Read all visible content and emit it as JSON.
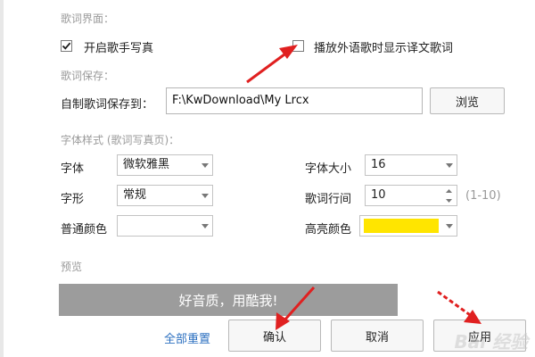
{
  "sections": {
    "lyrics_ui": "歌词界面：",
    "lyrics_save": "歌词保存：",
    "font_style": "字体样式 (歌词写真页)：",
    "preview": "预览"
  },
  "options": {
    "singer_photo": {
      "label": "开启歌手写真",
      "checked": true
    },
    "show_translation": {
      "label": "播放外语歌时显示译文歌词",
      "checked": false
    }
  },
  "save": {
    "label": "自制歌词保存到：",
    "path": "F:\\KwDownload\\My Lrcx",
    "browse_label": "浏览"
  },
  "font": {
    "family_label": "字体",
    "family_value": "微软雅黑",
    "style_label": "字形",
    "style_value": "常规",
    "normal_color_label": "普通颜色",
    "normal_color": "#ffffff",
    "size_label": "字体大小",
    "size_value": "16",
    "line_spacing_label": "歌词行间",
    "line_spacing_value": "10",
    "line_spacing_range": "(1-10)",
    "highlight_color_label": "高亮颜色",
    "highlight_color": "#ffe500"
  },
  "preview_text": "好音质，用酷我!",
  "footer": {
    "reset_label": "全部重置",
    "ok_label": "确认",
    "cancel_label": "取消",
    "apply_label": "应用"
  },
  "colors": {
    "annotation_red": "#e02020",
    "link_blue": "#2b6fc0",
    "preview_bg": "#9c9c9c"
  },
  "watermark": "Bai 经验"
}
